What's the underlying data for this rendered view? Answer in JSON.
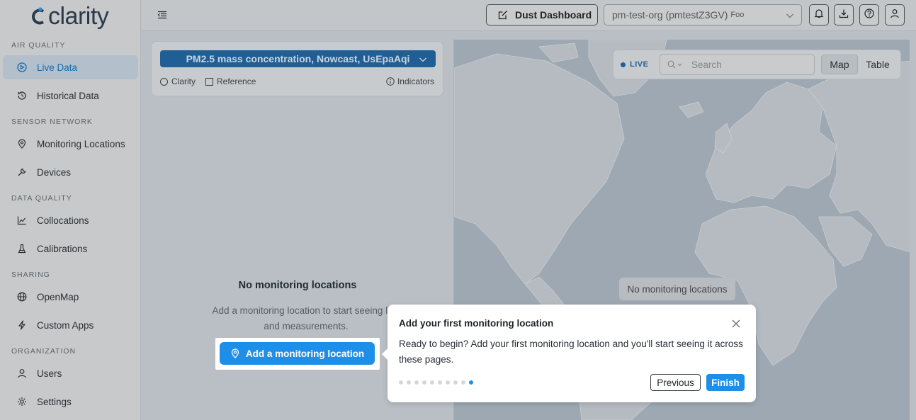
{
  "app": {
    "logo_text": "clarity"
  },
  "sidebar": {
    "sections": [
      {
        "label": "AIR QUALITY"
      },
      {
        "label": "SENSOR NETWORK"
      },
      {
        "label": "DATA QUALITY"
      },
      {
        "label": "SHARING"
      },
      {
        "label": "ORGANIZATION"
      }
    ],
    "items": [
      {
        "label": "Live Data",
        "icon": "play-circle-icon",
        "active": true
      },
      {
        "label": "Historical Data",
        "icon": "history-icon"
      },
      {
        "label": "Monitoring Locations",
        "icon": "location-pin-icon"
      },
      {
        "label": "Devices",
        "icon": "wrench-icon"
      },
      {
        "label": "Collocations",
        "icon": "line-chart-icon"
      },
      {
        "label": "Calibrations",
        "icon": "flask-icon"
      },
      {
        "label": "OpenMap",
        "icon": "globe-icon"
      },
      {
        "label": "Custom Apps",
        "icon": "lightning-icon"
      },
      {
        "label": "Users",
        "icon": "user-icon"
      },
      {
        "label": "Settings",
        "icon": "gear-icon"
      }
    ]
  },
  "topbar": {
    "dust_dashboard_label": "Dust Dashboard",
    "org_select": {
      "value": "pm-test-org (pmtestZ3GV)",
      "sub": "Foo"
    },
    "icons": [
      "bell-icon",
      "download-icon",
      "help-icon",
      "account-icon"
    ]
  },
  "filters": {
    "pollutant": "PM2.5 mass concentration, Nowcast, UsEpaAqi",
    "options": {
      "clarity": "Clarity",
      "reference": "Reference"
    },
    "indicators_label": "Indicators"
  },
  "empty_state": {
    "title": "No monitoring locations",
    "text": "Add a monitoring location to start seeing live data and measurements.",
    "line1": "Add a monitoring location to start seeing live",
    "line2": "and measurements.",
    "button": "Add a monitoring location"
  },
  "map": {
    "live_label": "LIVE",
    "search_placeholder": "Search",
    "view_map": "Map",
    "view_table": "Table",
    "empty_label": "No monitoring locations"
  },
  "tour": {
    "title": "Add your first monitoring location",
    "body": "Ready to begin? Add your first monitoring location and you'll start seeing it across these pages.",
    "total_steps": 10,
    "current_step": 10,
    "previous_label": "Previous",
    "finish_label": "Finish"
  },
  "colors": {
    "accent": "#1d8fe8",
    "active_nav_text": "#0b6ab5",
    "pollutant_bg": "#1f5f96"
  }
}
